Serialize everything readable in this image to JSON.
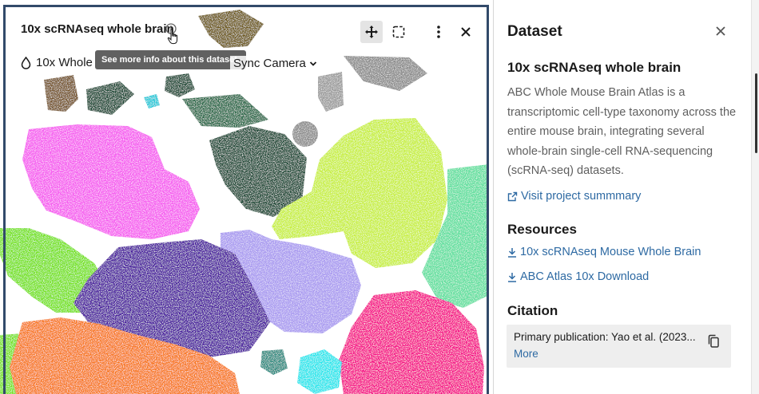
{
  "viewer": {
    "title": "10x scRNAseq whole brain",
    "tooltip": "See more info about this dataset.",
    "layer_label": "10x Whole",
    "sync_camera_label": "Sync Camera",
    "clusters": [
      {
        "name": "magenta",
        "color": "#f65cf0"
      },
      {
        "name": "dark-green",
        "color": "#1c4a36"
      },
      {
        "name": "lime",
        "color": "#c8ef3c"
      },
      {
        "name": "indigo",
        "color": "#4a1a9e"
      },
      {
        "name": "lavender",
        "color": "#a99af0"
      },
      {
        "name": "orange",
        "color": "#f7781a"
      },
      {
        "name": "pink",
        "color": "#f50f88"
      },
      {
        "name": "light-green",
        "color": "#76e21b"
      },
      {
        "name": "mint",
        "color": "#5fdf9e"
      },
      {
        "name": "cyan",
        "color": "#22e6ec"
      },
      {
        "name": "brown",
        "color": "#74532a"
      },
      {
        "name": "olive",
        "color": "#6e5a1e"
      },
      {
        "name": "gray",
        "color": "#8a8a8a"
      },
      {
        "name": "teal",
        "color": "#2a8a7f"
      }
    ]
  },
  "panel": {
    "title": "Dataset",
    "dataset_name": "10x scRNAseq whole brain",
    "description": "ABC Whole Mouse Brain Atlas is a transcriptomic cell-type taxonomy across the entire mouse brain, integrating several whole-brain single-cell RNA-sequencing (scRNA-seq) datasets.",
    "visit_link": "Visit project summmary",
    "resources_title": "Resources",
    "resources": [
      "10x scRNAseq Mouse Whole Brain",
      "ABC Atlas 10x Download"
    ],
    "citation_title": "Citation",
    "citation_text": "Primary publication: Yao et al. (2023...",
    "citation_more": "More"
  }
}
